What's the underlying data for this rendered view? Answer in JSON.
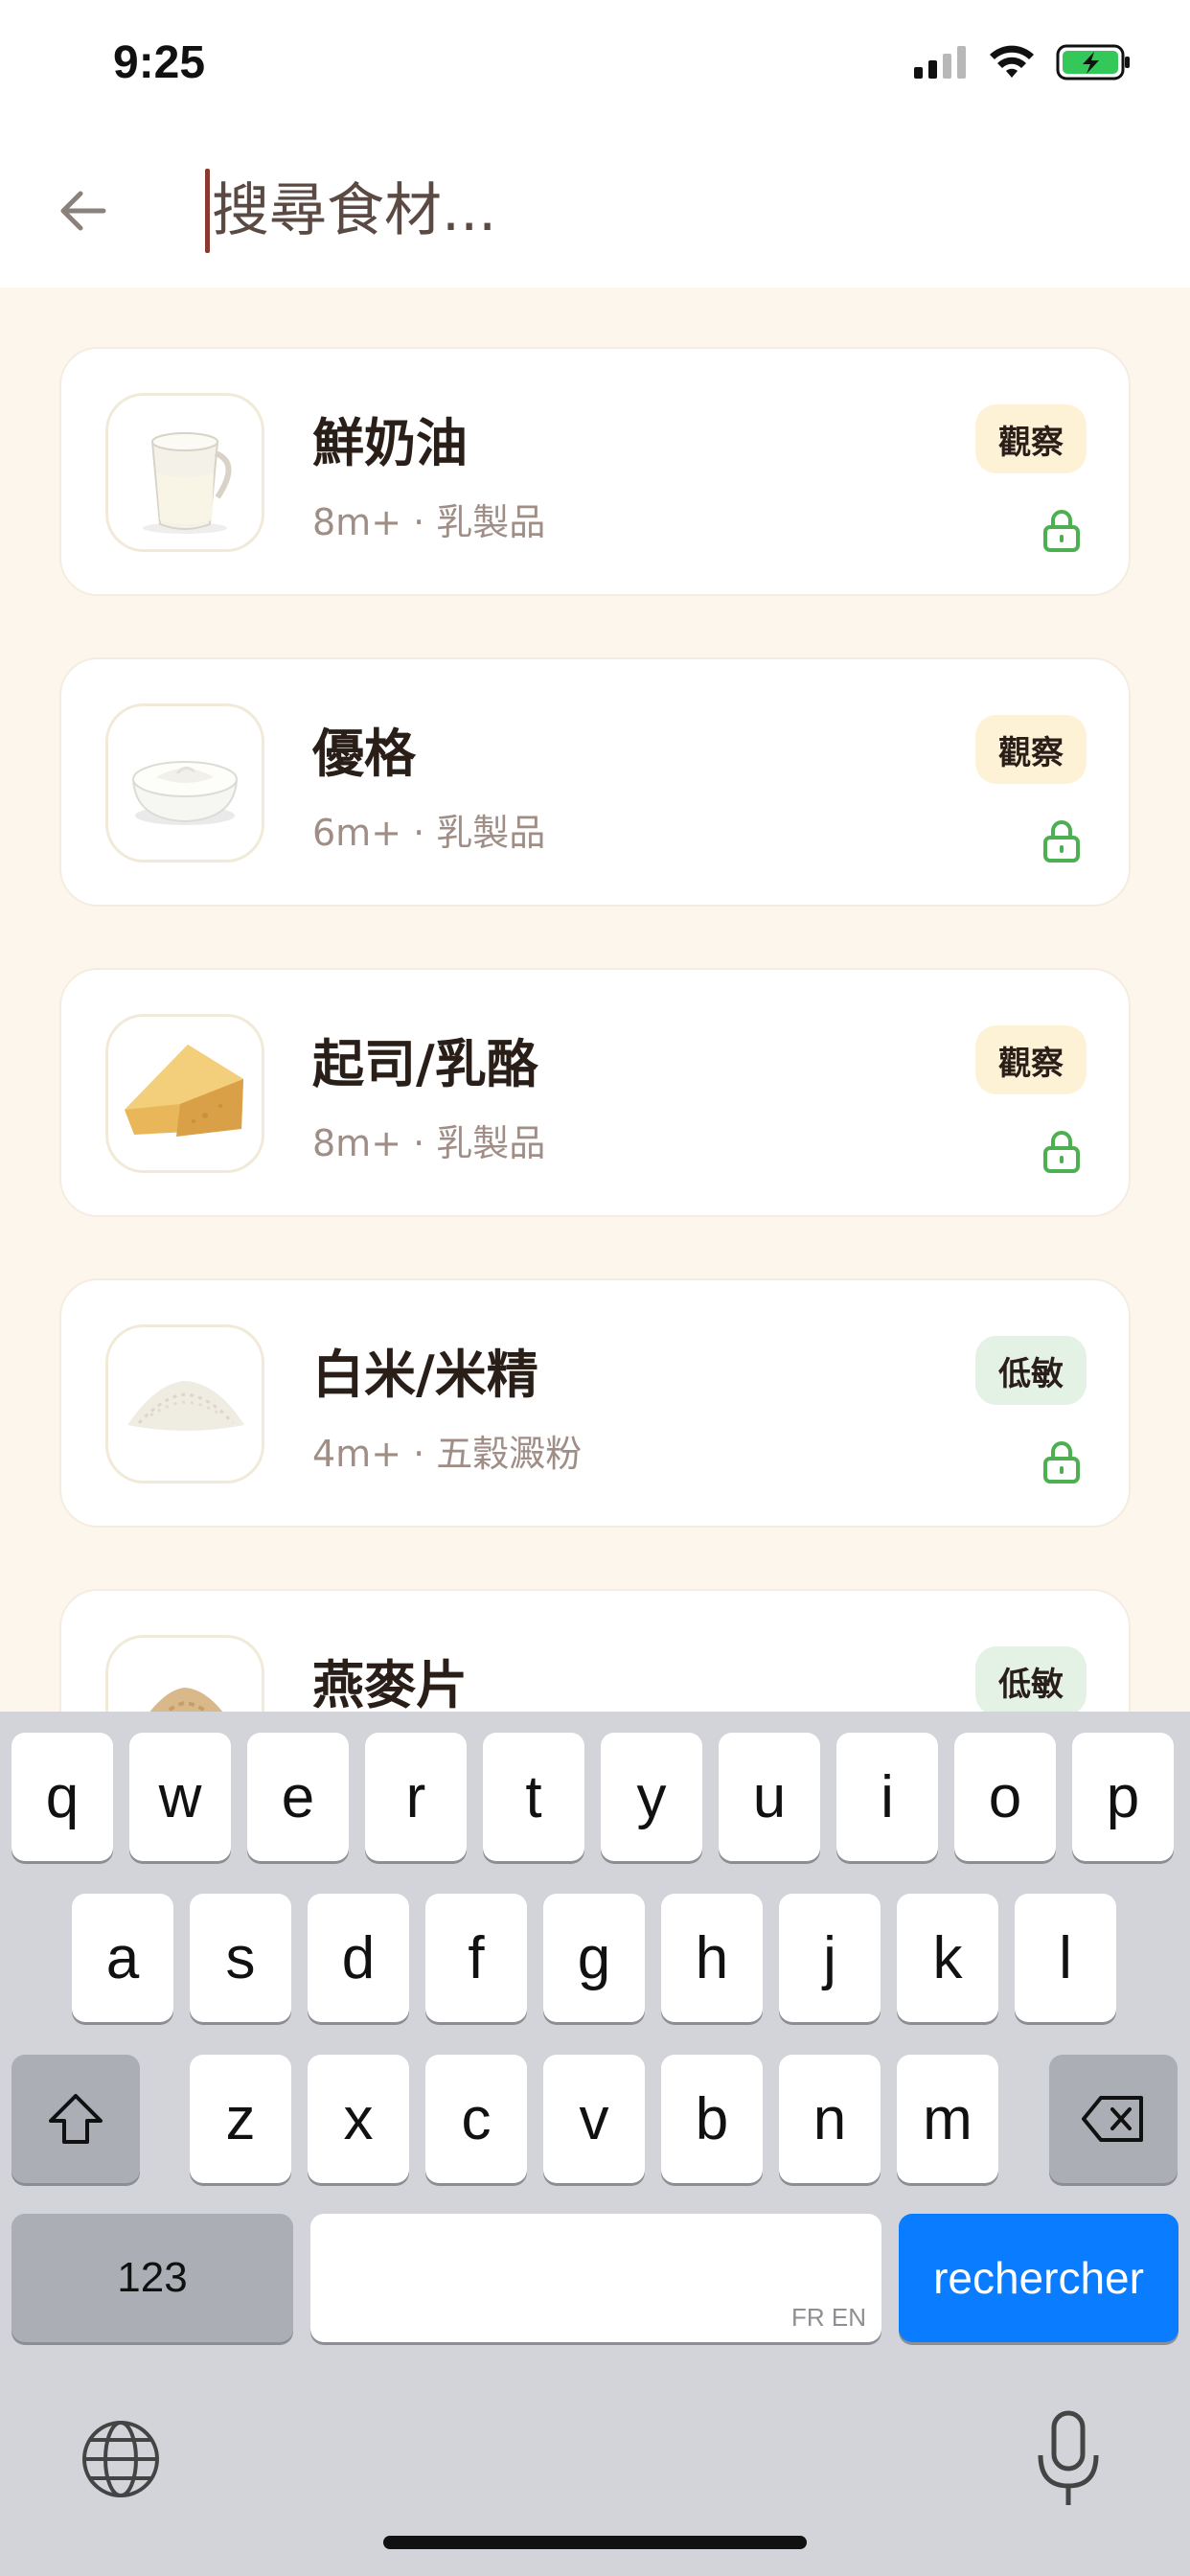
{
  "status_bar": {
    "time": "9:25",
    "battery_color": "#34c759"
  },
  "header": {
    "search_placeholder": "搜尋食材...",
    "back_icon": "arrow-left-icon"
  },
  "colors": {
    "list_bg": "#fdf6ec",
    "observe_badge": "#fdf1d6",
    "low_badge": "#e4f2e6",
    "lock_green": "#4caf50",
    "action_key": "#0a7cff"
  },
  "items": [
    {
      "name": "鮮奶油",
      "meta": "8m+ · 乳製品",
      "badge": "觀察",
      "badge_type": "observe",
      "image": "cream-jug-image",
      "locked": true
    },
    {
      "name": "優格",
      "meta": "6m+ · 乳製品",
      "badge": "觀察",
      "badge_type": "observe",
      "image": "yogurt-bowl-image",
      "locked": true
    },
    {
      "name": "起司/乳酪",
      "meta": "8m+ · 乳製品",
      "badge": "觀察",
      "badge_type": "observe",
      "image": "cheese-wedge-image",
      "locked": true
    },
    {
      "name": "白米/米精",
      "meta": "4m+ · 五穀澱粉",
      "badge": "低敏",
      "badge_type": "low",
      "image": "rice-pile-image",
      "locked": true
    },
    {
      "name": "燕麥片",
      "meta": "",
      "badge": "低敏",
      "badge_type": "low",
      "image": "oats-pile-image",
      "locked": true
    }
  ],
  "keyboard": {
    "row1": [
      "q",
      "w",
      "e",
      "r",
      "t",
      "y",
      "u",
      "i",
      "o",
      "p"
    ],
    "row2": [
      "a",
      "s",
      "d",
      "f",
      "g",
      "h",
      "j",
      "k",
      "l"
    ],
    "row3": [
      "z",
      "x",
      "c",
      "v",
      "b",
      "n",
      "m"
    ],
    "numbers_label": "123",
    "space_hint": "FR EN",
    "action_label": "rechercher",
    "shift_icon": "shift-icon",
    "delete_icon": "delete-icon",
    "globe_icon": "globe-icon",
    "mic_icon": "microphone-icon"
  }
}
